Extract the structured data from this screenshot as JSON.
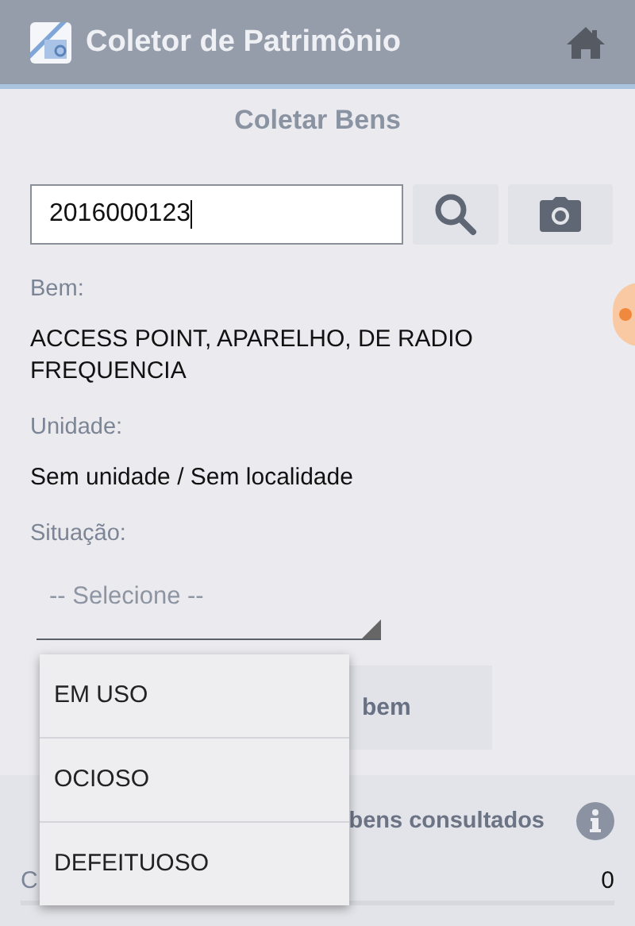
{
  "app_bar": {
    "title": "Coletor de Patrimônio"
  },
  "page_title": "Coletar Bens",
  "search": {
    "value": "2016000123"
  },
  "fields": [
    {
      "label": "Bem:",
      "value": "ACCESS POINT, APARELHO, DE RADIO FREQUENCIA"
    },
    {
      "label": "Unidade:",
      "value": "Sem unidade / Sem localidade"
    }
  ],
  "situacao": {
    "label": "Situação:",
    "placeholder": "-- Selecione --",
    "expanded": true,
    "options": [
      "EM USO",
      "OCIOSO",
      "DEFEITUOSO"
    ]
  },
  "include_button": "bem",
  "info": {
    "title": "bens consultados",
    "rows": [
      {
        "label": "C",
        "value": "0"
      }
    ]
  }
}
